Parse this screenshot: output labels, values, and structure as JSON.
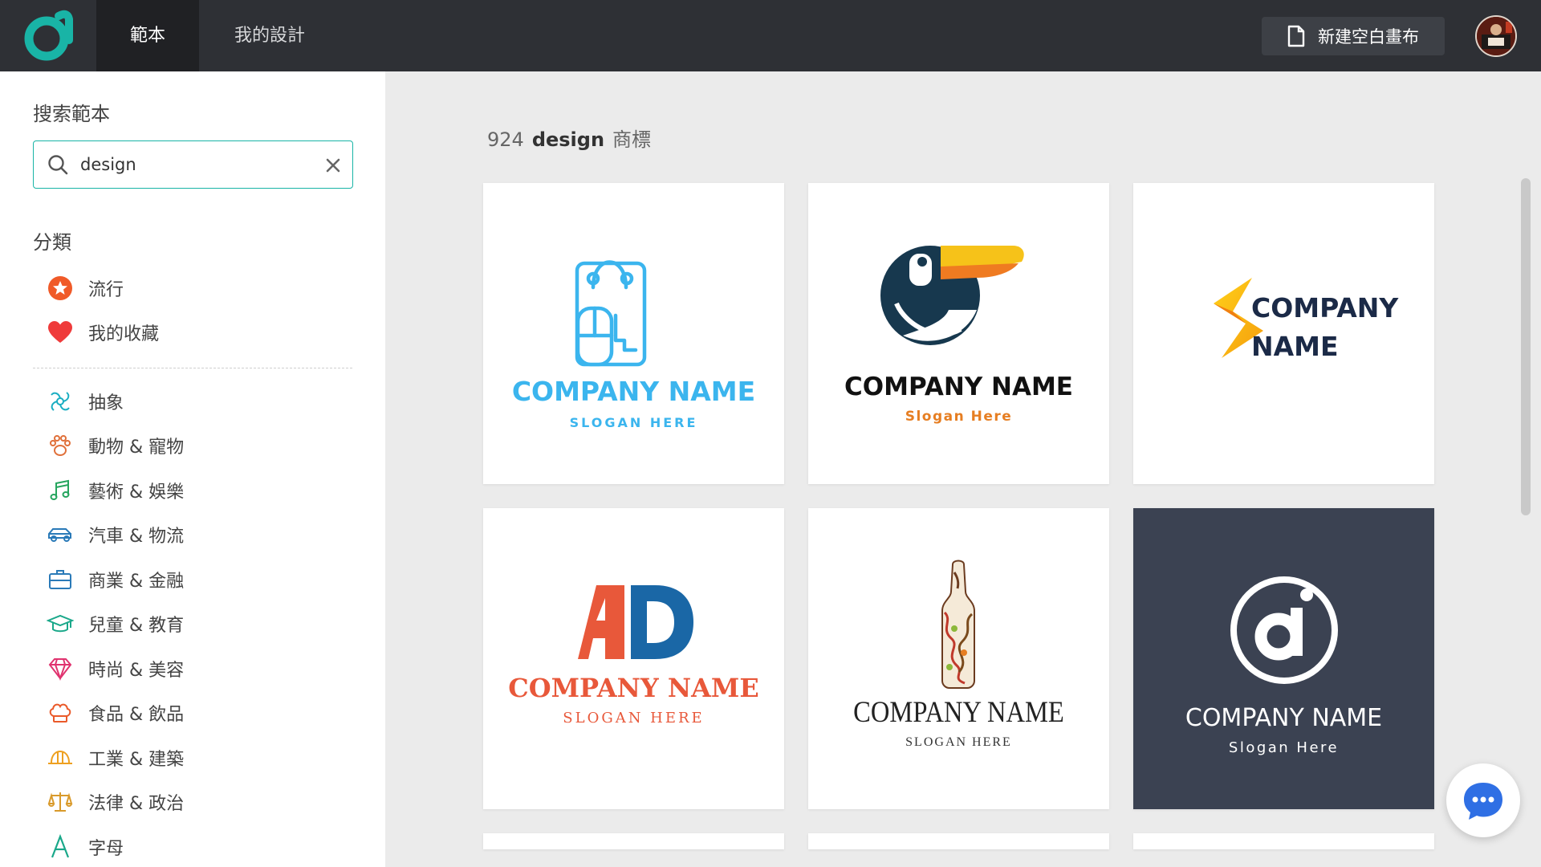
{
  "topbar": {
    "tabs": [
      {
        "label": "範本",
        "active": true
      },
      {
        "label": "我的設計",
        "active": false
      }
    ],
    "new_canvas_label": "新建空白畫布",
    "colors": {
      "bar": "#2e3035",
      "active_tab": "#202124",
      "brand": "#19b4a6"
    }
  },
  "sidebar": {
    "search_title": "搜索範本",
    "search": {
      "value": "design",
      "placeholder": ""
    },
    "category_title": "分類",
    "pinned": [
      {
        "label": "流行",
        "icon": "star-badge-icon"
      },
      {
        "label": "我的收藏",
        "icon": "heart-icon"
      }
    ],
    "categories": [
      {
        "label": "抽象",
        "icon": "abstract-swirl-icon"
      },
      {
        "label": "動物 & 寵物",
        "icon": "paw-icon"
      },
      {
        "label": "藝術 & 娛樂",
        "icon": "music-note-icon"
      },
      {
        "label": "汽車 & 物流",
        "icon": "car-icon"
      },
      {
        "label": "商業 & 金融",
        "icon": "briefcase-icon"
      },
      {
        "label": "兒童 & 教育",
        "icon": "graduation-cap-icon"
      },
      {
        "label": "時尚 & 美容",
        "icon": "diamond-icon"
      },
      {
        "label": "食品 & 飲品",
        "icon": "chef-hat-icon"
      },
      {
        "label": "工業 & 建築",
        "icon": "hard-hat-icon"
      },
      {
        "label": "法律 & 政治",
        "icon": "scales-icon"
      },
      {
        "label": "字母",
        "icon": "letter-a-icon"
      }
    ]
  },
  "results": {
    "count": "924",
    "query": "design",
    "suffix": "商標"
  },
  "templates": [
    {
      "name": "COMPANY NAME",
      "slogan": "SLOGAN HERE",
      "icon": "shopping-bag-mouse-icon",
      "color": "#3bb5ee"
    },
    {
      "name": "COMPANY NAME",
      "slogan": "Slogan Here",
      "icon": "toucan-icon",
      "color": "#e67e22"
    },
    {
      "name": "COMPANY",
      "name2": "NAME",
      "icon": "lightning-bolt-icon",
      "color": "#1b2a47"
    },
    {
      "name": "COMPANY NAME",
      "slogan": "SLOGAN HERE",
      "monogram": "AD",
      "color": "#e8583a"
    },
    {
      "name": "COMPANY NAME",
      "slogan": "SLOGAN HERE",
      "icon": "ornate-bottle-icon",
      "color": "#222222"
    },
    {
      "name": "COMPANY NAME",
      "slogan": "Slogan Here",
      "monogram": "di",
      "color": "#3b4252"
    }
  ]
}
